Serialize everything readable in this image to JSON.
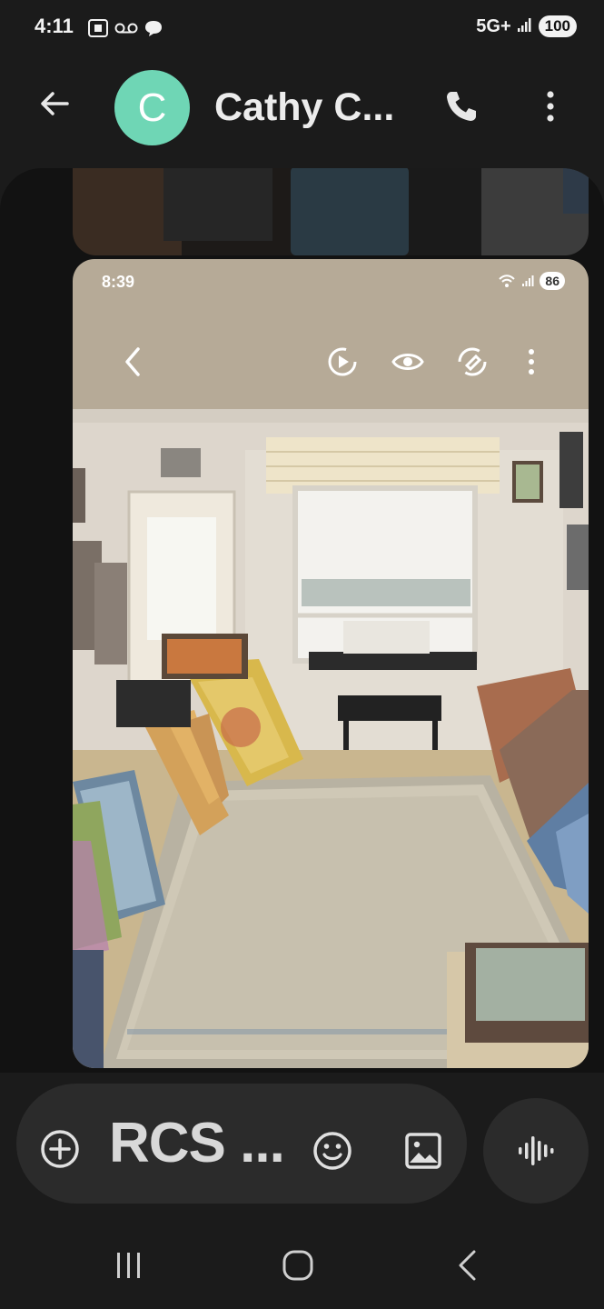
{
  "status_bar": {
    "time": "4:11",
    "network": "5G+",
    "battery": "100"
  },
  "header": {
    "avatar_letter": "C",
    "contact_name": "Cathy C...",
    "avatar_color": "#6fd6b5"
  },
  "embedded_screenshot": {
    "time": "8:39",
    "battery": "86"
  },
  "composer": {
    "text": "RCS ..."
  },
  "icons": {
    "back": "arrow-left-icon",
    "call": "phone-icon",
    "more": "more-vert-icon",
    "add": "plus-circle-icon",
    "emoji": "emoji-icon",
    "gallery": "image-icon",
    "voice": "waveform-icon"
  }
}
